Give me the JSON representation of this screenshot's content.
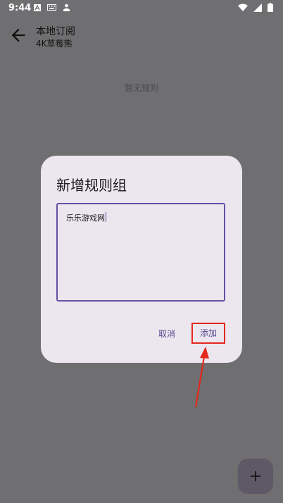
{
  "status_bar": {
    "time": "9:44",
    "left_icons": [
      "a-icon",
      "keyboard-icon",
      "person-icon"
    ],
    "right_icons": [
      "wifi-icon",
      "signal-icon",
      "battery-icon"
    ]
  },
  "app_bar": {
    "title": "本地订阅",
    "subtitle": "4K草莓熊"
  },
  "main": {
    "empty_text": "暂无规则"
  },
  "dialog": {
    "title": "新增规则组",
    "input_value": "乐乐游戏网",
    "cancel_label": "取消",
    "add_label": "添加"
  },
  "fab": {
    "icon": "plus-icon"
  },
  "colors": {
    "scrim": "#6f6e70",
    "dialog_bg": "#ece6ef",
    "accent": "#6551a4",
    "annotation_red": "#e3281e"
  }
}
